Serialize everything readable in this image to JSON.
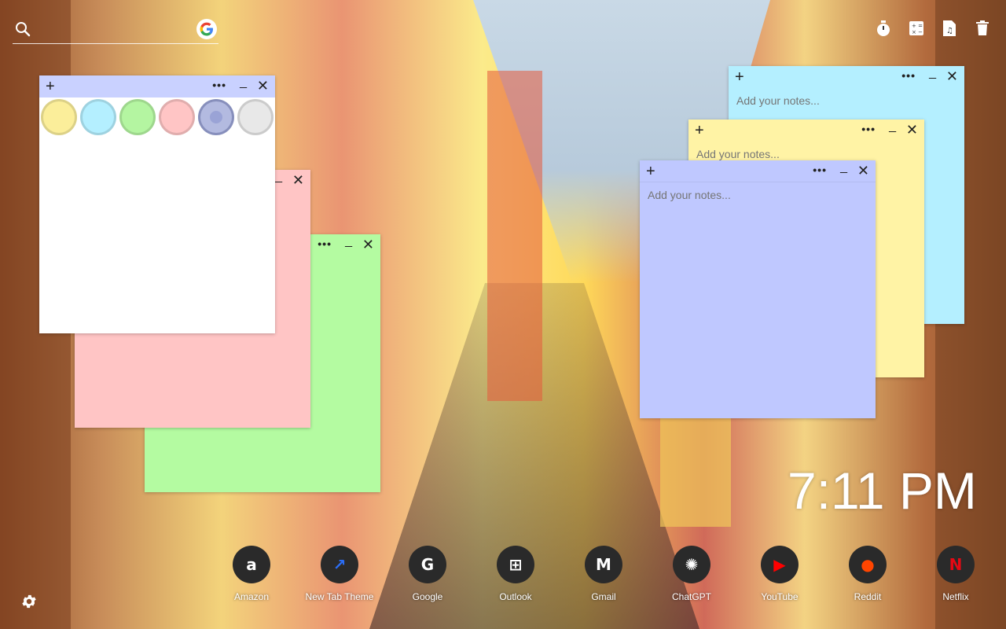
{
  "search": {
    "placeholder": "",
    "icon": "search-icon",
    "engine_icon": "google-icon"
  },
  "tools": [
    {
      "name": "timer-icon"
    },
    {
      "name": "calculator-icon"
    },
    {
      "name": "music-file-icon"
    },
    {
      "name": "trash-icon"
    }
  ],
  "note_controls": {
    "add": "+",
    "more": "•••",
    "minimize": "_",
    "close": "✕"
  },
  "notes": {
    "placeholder": "Add your notes...",
    "white": {
      "color": "#ffffff"
    },
    "pink": {
      "color": "#ffc5c5"
    },
    "green": {
      "color": "#b4fba1"
    },
    "cyan": {
      "color": "#b4efff"
    },
    "yellow": {
      "color": "#fff3a5"
    },
    "blue": {
      "color": "#bfc8ff"
    }
  },
  "palette_colors": [
    "#fbee9a",
    "#b4efff",
    "#b4f5a1",
    "#ffc5c5",
    "#9aa3d6",
    "#e8e8e8"
  ],
  "clock": {
    "time": "7:11 PM"
  },
  "apps": [
    {
      "label": "Amazon",
      "glyph": "a"
    },
    {
      "label": "New Tab Theme",
      "glyph": "↗"
    },
    {
      "label": "Google",
      "glyph": "G"
    },
    {
      "label": "Outlook",
      "glyph": "⊞"
    },
    {
      "label": "Gmail",
      "glyph": "M"
    },
    {
      "label": "ChatGPT",
      "glyph": "✺"
    },
    {
      "label": "YouTube",
      "glyph": "▶"
    },
    {
      "label": "Reddit",
      "glyph": "●"
    },
    {
      "label": "Netflix",
      "glyph": "N"
    }
  ]
}
